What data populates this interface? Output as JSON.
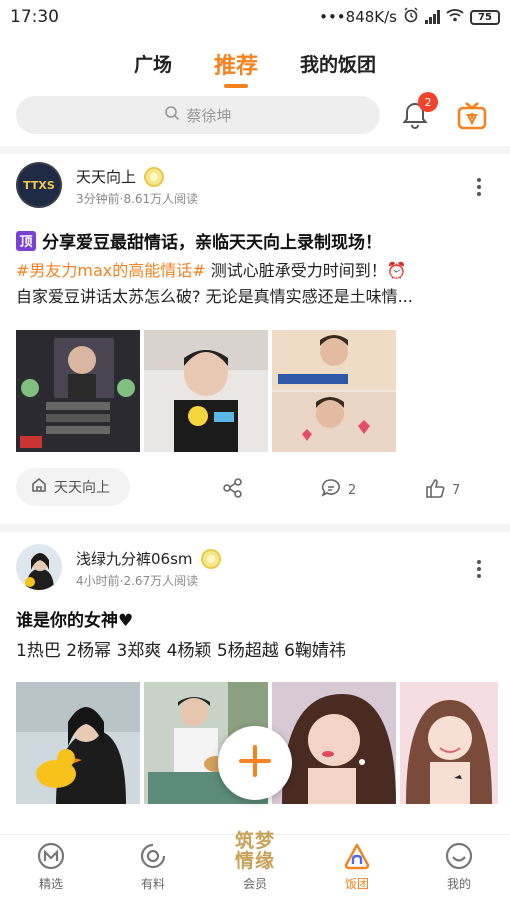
{
  "status_bar": {
    "time": "17:30",
    "network_speed": "•••848K/s",
    "battery": "75"
  },
  "top_tabs": [
    {
      "label": "广场",
      "active": false
    },
    {
      "label": "推荐",
      "active": true
    },
    {
      "label": "我的饭团",
      "active": false
    }
  ],
  "search": {
    "placeholder": "蔡徐坤"
  },
  "notifications": {
    "count": "2"
  },
  "posts": [
    {
      "author": "天天向上",
      "meta": "3分钟前·8.61万人阅读",
      "pin_label": "顶",
      "title": "分享爱豆最甜情话，亲临天天向上录制现场！",
      "hashtag": "#男友力max的高能情话#",
      "text_line1_rest": " 测试心脏承受力时间到！⏰",
      "text_line2": "自家爱豆讲话太苏怎么破? 无论是真情实感还是土味情...",
      "group_chip": "天天向上",
      "comments": "2",
      "likes": "7"
    },
    {
      "author": "浅绿九分裤06sm",
      "meta": "4小时前·2.67万人阅读",
      "title": "谁是你的女神♥",
      "text_line1": "1热巴 2杨幂 3郑爽 4杨颖 5杨超越 6鞠婧祎"
    }
  ],
  "bottom_nav": [
    {
      "label": "精选",
      "icon": "featured-icon",
      "active": false
    },
    {
      "label": "有料",
      "icon": "spiral-icon",
      "active": false
    },
    {
      "label": "会员",
      "icon": "member-logo",
      "logo_text": "筑梦情缘",
      "active": false
    },
    {
      "label": "饭团",
      "icon": "fan-group-icon",
      "active": true
    },
    {
      "label": "我的",
      "icon": "smile-face-icon",
      "active": false
    }
  ],
  "colors": {
    "accent": "#f5821f",
    "badge": "#f0432c",
    "pin": "#7a3fd3"
  }
}
